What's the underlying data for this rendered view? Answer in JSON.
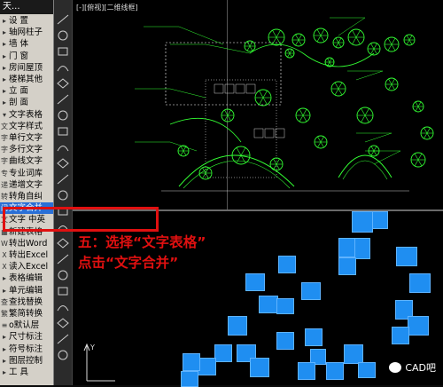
{
  "menu": {
    "title": "天...",
    "items": [
      {
        "label": "设  置",
        "mk": "▸"
      },
      {
        "label": "轴网柱子",
        "mk": "▸"
      },
      {
        "label": "墙  体",
        "mk": "▸"
      },
      {
        "label": "门  窗",
        "mk": "▸"
      },
      {
        "label": "房间屋顶",
        "mk": "▸"
      },
      {
        "label": "楼梯其他",
        "mk": "▸"
      },
      {
        "label": "立  面",
        "mk": "▸"
      },
      {
        "label": "剖  面",
        "mk": "▸"
      },
      {
        "label": "文字表格",
        "mk": "▾"
      },
      {
        "label": "文字样式",
        "mk": "文"
      },
      {
        "label": "单行文字",
        "mk": "字"
      },
      {
        "label": "多行文字",
        "mk": "字"
      },
      {
        "label": "曲线文字",
        "mk": "字"
      },
      {
        "label": "专业词库",
        "mk": "专"
      },
      {
        "label": "递增文字",
        "mk": "递"
      },
      {
        "label": "转角自纠",
        "mk": "转"
      },
      {
        "label": "文字合并",
        "mk": "闭",
        "selected": true
      },
      {
        "label": "文字 中英",
        "mk": "文"
      },
      {
        "label": "新建表格",
        "mk": "▦"
      },
      {
        "label": "转出Word",
        "mk": "W"
      },
      {
        "label": "转出Excel",
        "mk": "X"
      },
      {
        "label": "读入Excel",
        "mk": "X"
      },
      {
        "label": "表格编辑",
        "mk": "▸"
      },
      {
        "label": "单元编辑",
        "mk": "▸"
      },
      {
        "label": "查找替换",
        "mk": "查"
      },
      {
        "label": "繁简转换",
        "mk": "繁"
      },
      {
        "label": "o默认层",
        "mk": "≡"
      },
      {
        "label": "尺寸标注",
        "mk": "▸"
      },
      {
        "label": "符号标注",
        "mk": "▸"
      },
      {
        "label": "图层控制",
        "mk": "▸"
      },
      {
        "label": "工  具",
        "mk": "▸"
      }
    ]
  },
  "viewport": {
    "label": "[-][俯视][二维线框]"
  },
  "annotation": {
    "line1": "五：选择“文字表格”",
    "line2": "点击“文字合并”"
  },
  "watermark": {
    "text": "CAD吧"
  },
  "colors": {
    "highlight": "#e01010",
    "squares": "#1f8ef1",
    "drawing": "#33ff33"
  }
}
